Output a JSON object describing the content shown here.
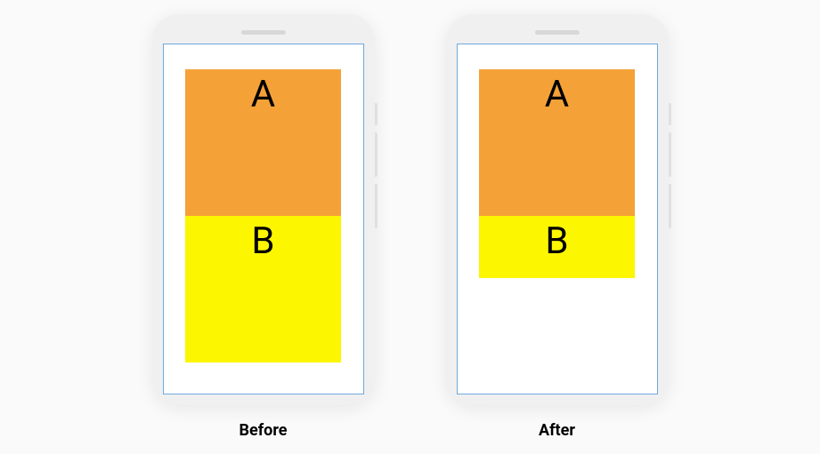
{
  "phones": {
    "before": {
      "caption": "Before",
      "blockA": {
        "label": "A"
      },
      "blockB": {
        "label": "B"
      }
    },
    "after": {
      "caption": "After",
      "blockA": {
        "label": "A"
      },
      "blockB": {
        "label": "B"
      }
    }
  },
  "colors": {
    "blockA": "#f4a238",
    "blockB": "#fcf600",
    "phoneBody": "#f0f0f0",
    "screenBorder": "#6fa8dc",
    "background": "#fafafa"
  }
}
